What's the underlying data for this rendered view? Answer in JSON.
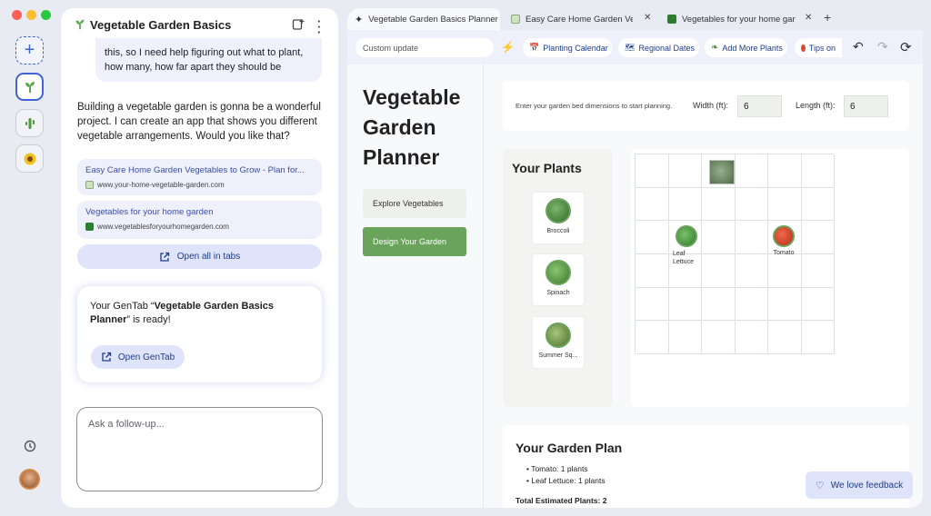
{
  "window": {
    "traffic_lights": [
      "#ff5f57",
      "#febc2e",
      "#28c840"
    ]
  },
  "rail": {
    "items": [
      "new-tab",
      "vegetable-garden",
      "cactus",
      "sunflower"
    ],
    "history_icon": "history-icon"
  },
  "chat": {
    "title": "Vegetable Garden Basics",
    "user_message": "this, so I need help figuring out what to plant, how many, how far apart they should be",
    "assistant_message": "Building a vegetable garden is gonna be a wonderful project. I can create an app that shows you different vegetable arrangements. Would you like that?",
    "sources": [
      {
        "title": "Easy Care Home Garden Vegetables to Grow - Plan for...",
        "url": "www.your-home-vegetable-garden.com"
      },
      {
        "title": "Vegetables for your home garden",
        "url": "www.vegetablesforyourhomegarden.com"
      }
    ],
    "open_all_label": "Open all in tabs",
    "gentab_prefix": "Your GenTab “",
    "gentab_name": "Vegetable Garden Basics Planner",
    "gentab_suffix": "” is ready!",
    "open_gentab_label": "Open GenTab",
    "followup_placeholder": "Ask a follow-up..."
  },
  "tabs": [
    {
      "label": "Vegetable Garden Basics Planner",
      "active": true
    },
    {
      "label": "Easy Care Home Garden Vegetables",
      "active": false
    },
    {
      "label": "Vegetables for your home garden",
      "active": false
    }
  ],
  "toolbar": {
    "custom_update_placeholder": "Custom update",
    "chips": [
      "Planting Calendar",
      "Regional Dates",
      "Add More Plants",
      "Tips on"
    ]
  },
  "app": {
    "title_line1": "Vegetable",
    "title_line2": "Garden",
    "title_line3": "Planner",
    "nav": [
      "Explore Vegetables",
      "Design Your Garden"
    ],
    "dimensions_prompt": "Enter your garden bed dimensions to start planning.",
    "width_label": "Width (ft):",
    "width_value": "6",
    "length_label": "Length (ft):",
    "length_value": "6",
    "your_plants_title": "Your Plants",
    "plants": [
      "Broccoli",
      "Spinach",
      "Summer Sq..."
    ],
    "placed": [
      {
        "name": "Leaf\nLettuce",
        "col": 1,
        "row": 2
      },
      {
        "name": "Tomato",
        "col": 4,
        "row": 2
      }
    ],
    "plan_title": "Your Garden Plan",
    "plan_items": [
      "Tomato: 1 plants",
      "Leaf Lettuce: 1 plants"
    ],
    "plan_total": "Total Estimated Plants: 2",
    "feedback_label": "We love feedback"
  },
  "colors": {
    "accent_green": "#6aa35c",
    "link_blue": "#3c4fa7",
    "chip_bg": "#dfe4fb"
  }
}
